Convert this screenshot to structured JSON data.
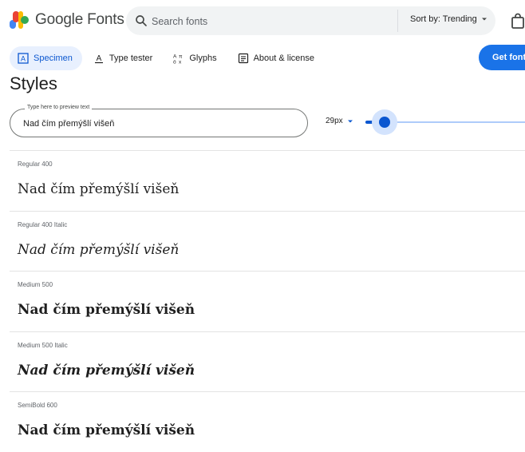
{
  "header": {
    "brand": "Google Fonts",
    "search_placeholder": "Search fonts",
    "sort_label": "Sort by: Trending",
    "logo_colors": [
      "#4285f4",
      "#ea4335",
      "#fbbc04",
      "#34a853"
    ]
  },
  "tabs": [
    {
      "label": "Specimen",
      "icon": "specimen-icon",
      "active": true
    },
    {
      "label": "Type tester",
      "icon": "type-tester-icon",
      "active": false
    },
    {
      "label": "Glyphs",
      "icon": "glyphs-icon",
      "active": false
    },
    {
      "label": "About & license",
      "icon": "about-icon",
      "active": false
    }
  ],
  "get_font_label": "Get font",
  "section_title": "Styles",
  "preview": {
    "label": "Type here to preview text",
    "value": "Nad čím přemýšlí višeň"
  },
  "size": {
    "value_label": "29px",
    "slider_fraction": 0.12
  },
  "styles": [
    {
      "name": "Regular 400",
      "sample": "Nad čím přemýšlí višeň",
      "weight": 400,
      "italic": false
    },
    {
      "name": "Regular 400 Italic",
      "sample": "Nad čím přemýšlí višeň",
      "weight": 400,
      "italic": true
    },
    {
      "name": "Medium 500",
      "sample": "Nad čím přemýšlí višeň",
      "weight": 500,
      "italic": false
    },
    {
      "name": "Medium 500 Italic",
      "sample": "Nad čím přemýšlí višeň",
      "weight": 500,
      "italic": true
    },
    {
      "name": "SemiBold 600",
      "sample": "Nad čím přemýšlí višeň",
      "weight": 600,
      "italic": false
    }
  ],
  "colors": {
    "accent": "#0b57d0",
    "button": "#1a73e8",
    "active_tab_bg": "#e8f0fe"
  }
}
